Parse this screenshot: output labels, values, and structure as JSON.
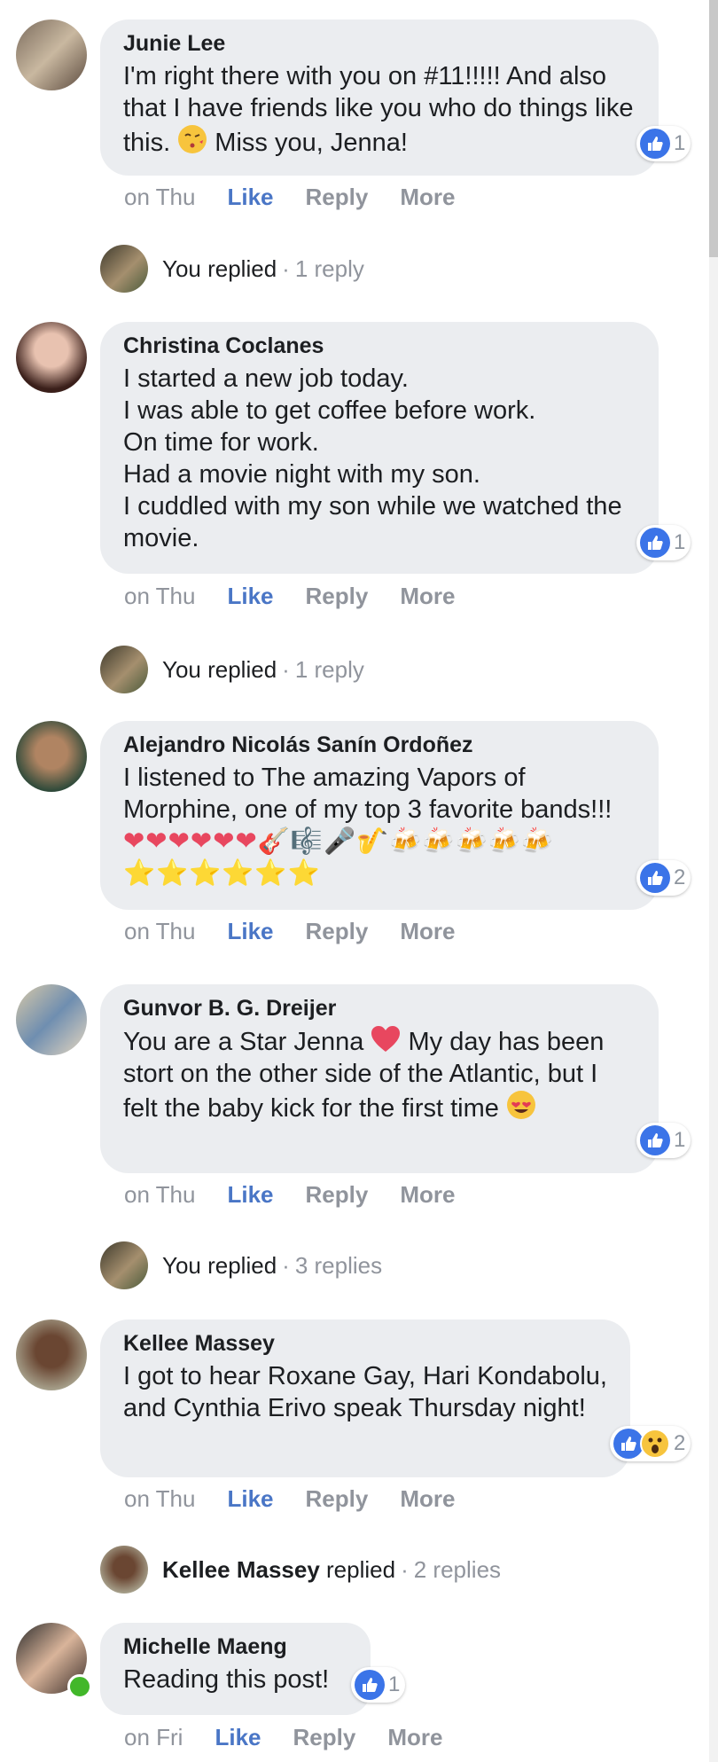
{
  "comments": [
    {
      "author": "Junie Lee",
      "text_before": "I'm right there with you on #11!!!!! And also that I have friends like you who do things like this. ",
      "text_after": " Miss you, Jenna!",
      "reaction_count": "1",
      "time": "on Thu",
      "like": "Like",
      "reply": "Reply",
      "more": "More"
    },
    {
      "author": "Christina Coclanes",
      "text": "I started a new job today.\nI was able to get coffee before work.\nOn time for work.\nHad a movie night with my son.\nI cuddled with my son while we watched the movie.",
      "reaction_count": "1",
      "time": "on Thu",
      "like": "Like",
      "reply": "Reply",
      "more": "More"
    },
    {
      "author": "Alejandro Nicolás Sanín Ordoñez",
      "text": "I listened to The amazing Vapors of Morphine, one of my top 3 favorite bands!!! ",
      "emoji_line": "❤❤❤❤❤❤🎸🎼🎤🎷🍻🍻🍻🍻🍻⭐⭐⭐⭐⭐⭐",
      "reaction_count": "2",
      "time": "on Thu",
      "like": "Like",
      "reply": "Reply",
      "more": "More"
    },
    {
      "author": "Gunvor B. G. Dreijer",
      "text_before": "You are a Star Jenna ",
      "text_middle": " My day has been stort on the other side of the Atlantic, but I felt the baby kick for the first time ",
      "reaction_count": "1",
      "time": "on Thu",
      "like": "Like",
      "reply": "Reply",
      "more": "More"
    },
    {
      "author": "Kellee Massey",
      "text": "I got to hear Roxane Gay, Hari Kondabolu, and Cynthia Erivo speak Thursday night!",
      "reaction_count": "2",
      "time": "on Thu",
      "like": "Like",
      "reply": "Reply",
      "more": "More"
    },
    {
      "author": "Michelle Maeng",
      "text": "Reading this post!",
      "reaction_count": "1",
      "time": "on Fri",
      "like": "Like",
      "reply": "Reply",
      "more": "More"
    }
  ],
  "replies": [
    {
      "who": "You replied",
      "count": "1 reply"
    },
    {
      "who": "You replied",
      "count": "1 reply"
    },
    {
      "who": "You replied",
      "count": "3 replies"
    },
    {
      "who_bold": "Kellee Massey",
      "who_rest": " replied",
      "count": "2 replies"
    }
  ],
  "separator": "·",
  "icons": {
    "like": "thumbs-up-icon",
    "wow": "wow-face-icon",
    "kiss": "kissing-face-icon",
    "heart": "heart-icon",
    "heart_eyes": "heart-eyes-face-icon"
  },
  "colors": {
    "like_blue": "#3b74e8",
    "action_like": "#4a76c6",
    "bubble_bg": "#ebedf0",
    "muted": "#90949c",
    "online": "#42b72a"
  }
}
